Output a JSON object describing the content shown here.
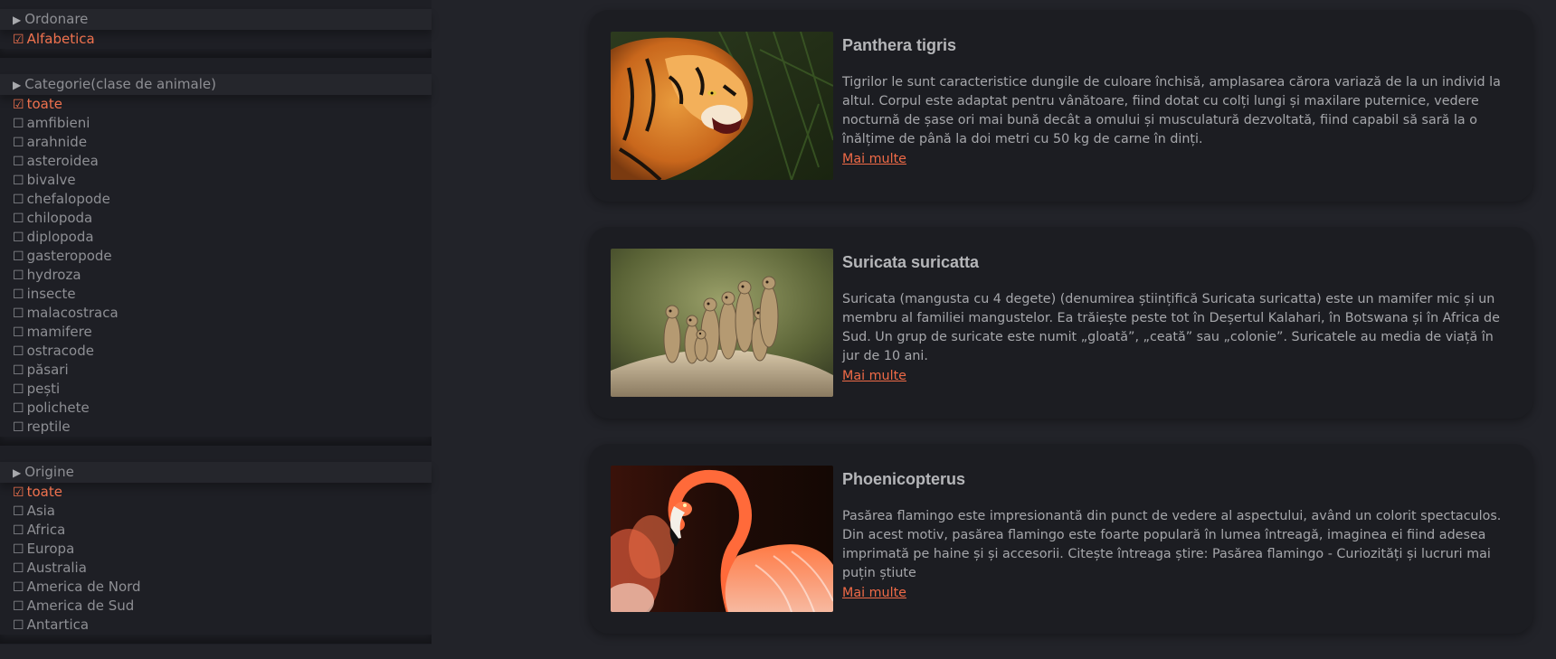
{
  "filters": {
    "ordonare": {
      "title": "Ordonare",
      "options": [
        {
          "label": "Alfabetica",
          "checked": true
        }
      ]
    },
    "categorie": {
      "title": "Categorie(clase de animale)",
      "options": [
        {
          "label": "toate",
          "checked": true
        },
        {
          "label": "amfibieni",
          "checked": false
        },
        {
          "label": "arahnide",
          "checked": false
        },
        {
          "label": "asteroidea",
          "checked": false
        },
        {
          "label": "bivalve",
          "checked": false
        },
        {
          "label": "chefalopode",
          "checked": false
        },
        {
          "label": "chilopoda",
          "checked": false
        },
        {
          "label": "diplopoda",
          "checked": false
        },
        {
          "label": "gasteropode",
          "checked": false
        },
        {
          "label": "hydroza",
          "checked": false
        },
        {
          "label": "insecte",
          "checked": false
        },
        {
          "label": "malacostraca",
          "checked": false
        },
        {
          "label": "mamifere",
          "checked": false
        },
        {
          "label": "ostracode",
          "checked": false
        },
        {
          "label": "păsari",
          "checked": false
        },
        {
          "label": "pești",
          "checked": false
        },
        {
          "label": "polichete",
          "checked": false
        },
        {
          "label": "reptile",
          "checked": false
        }
      ]
    },
    "origine": {
      "title": "Origine",
      "options": [
        {
          "label": "toate",
          "checked": true
        },
        {
          "label": "Asia",
          "checked": false
        },
        {
          "label": "Africa",
          "checked": false
        },
        {
          "label": "Europa",
          "checked": false
        },
        {
          "label": "Australia",
          "checked": false
        },
        {
          "label": "America de Nord",
          "checked": false
        },
        {
          "label": "America de Sud",
          "checked": false
        },
        {
          "label": "Antartica",
          "checked": false
        }
      ]
    }
  },
  "icons": {
    "expand": "triangle-right-icon",
    "checked": "checkbox-checked-icon",
    "unchecked": "checkbox-unchecked-icon"
  },
  "colors": {
    "accent": "#f0724e",
    "background": "#222329",
    "card": "#1c1d22"
  },
  "cards": [
    {
      "title": "Panthera tigris",
      "text": "Tigrilor le sunt caracteristice dungile de culoare închisă, amplasarea cărora variază de la un individ la altul. Corpul este adaptat pentru vânătoare, fiind dotat cu colți lungi și maxilare puternice, vedere nocturnă de șase ori mai bună decât a omului și musculatură dezvoltată, fiind capabil să sară la o înălțime de până la doi metri cu 50 kg de carne în dinți.",
      "link": "Mai multe"
    },
    {
      "title": "Suricata suricatta",
      "text": "Suricata (mangusta cu 4 degete) (denumirea științifică Suricata suricatta) este un mamifer mic și un membru al familiei mangustelor. Ea trăiește peste tot în Deșertul Kalahari, în Botswana și în Africa de Sud. Un grup de suricate este numit „gloată”, „ceată” sau „colonie”. Suricatele au media de viață în jur de 10 ani.",
      "link": "Mai multe"
    },
    {
      "title": "Phoenicopterus",
      "text": "Pasărea flamingo este impresionantă din punct de vedere al aspectului, având un colorit spectaculos. Din acest motiv, pasărea flamingo este foarte populară în lumea întreagă, imaginea ei fiind adesea imprimată pe haine și și accesorii. Citește întreaga știre: Pasărea flamingo - Curiozități și lucruri mai puțin știute",
      "link": "Mai multe"
    }
  ]
}
